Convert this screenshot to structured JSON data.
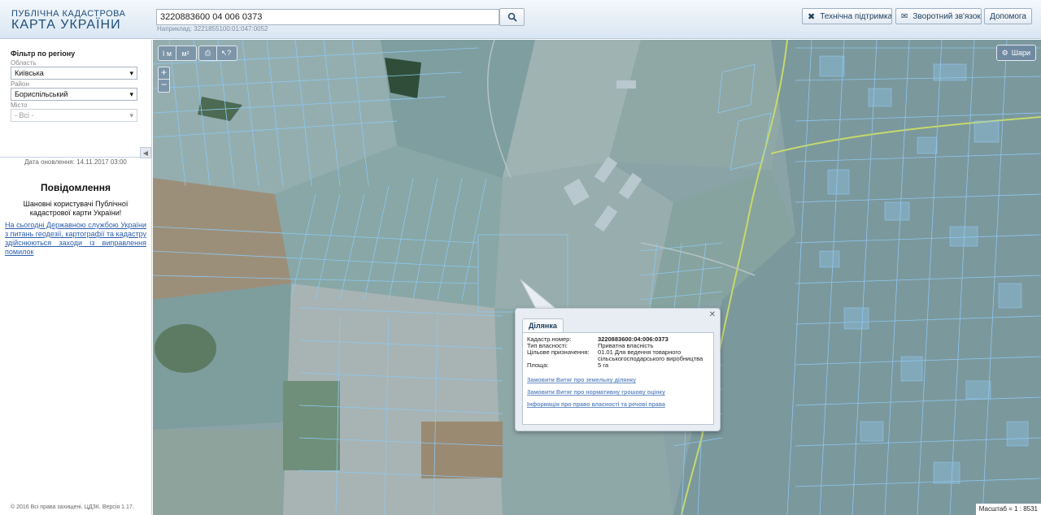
{
  "header": {
    "logo_line1": "ПУБЛІЧНА КАДАСТРОВА",
    "logo_line2": "КАРТА УКРАЇНИ",
    "search_value": "3220883600 04 006 0373",
    "search_hint": "Наприклад: 3221855100:01:047:0052",
    "buttons": {
      "support": "Технічна підтримка",
      "feedback": "Зворотний зв'язок",
      "help": "Допомога"
    }
  },
  "sidebar": {
    "filter_title": "Фільтр по регіону",
    "region_label": "Область",
    "region_value": "Київська",
    "district_label": "Район",
    "district_value": "Бориспільський",
    "city_label": "Місто",
    "city_value": "- Всі -",
    "update_date": "Дата оновлення: 14.11.2017 03:00",
    "notice_title": "Повідомлення",
    "notice_greeting": "Шановні користувачі Публічної кадастрової карти України!",
    "notice_link": "На сьогодні Державною службою України з питань геодезії, картографії та кадастру здійснюються заходи із виправлення помилок",
    "copyright": "© 2016 Всі права захищені. ЦДЗК. Версія 1.17."
  },
  "map": {
    "layers_label": "Шари",
    "scale_text": "Масштаб = 1 : 8531",
    "tools": {
      "measure_length": "I м",
      "measure_area": "м²",
      "zoom_in": "+",
      "zoom_out": "−"
    }
  },
  "popup": {
    "tab_label": "Ділянка",
    "fields": [
      {
        "key": "Кадастр.номер:",
        "value": "3220883600:04:006:0373",
        "bold": true
      },
      {
        "key": "Тип власності:",
        "value": "Приватна власність"
      },
      {
        "key": "Цільове призначення:",
        "value": "01.01 Для ведення товарного сільськогосподарського виробництва"
      },
      {
        "key": "Площа:",
        "value": "5 га"
      }
    ],
    "links": [
      "Замовити Витяг про земельну ділянку",
      "Замовити Витяг про нормативну грошову оцінку",
      "Інформація про право власності та речові права"
    ]
  },
  "colors": {
    "parcel_line": "#8ec8f0",
    "road": "#c6d96b",
    "link": "#6a8fc4"
  }
}
